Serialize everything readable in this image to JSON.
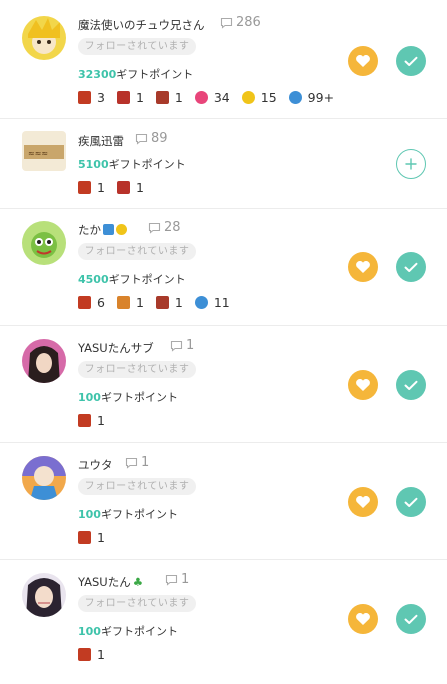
{
  "colors": {
    "accent": "#3ec3aa",
    "heart": "#f5b63a",
    "check": "#5fc7b2"
  },
  "users": [
    {
      "name": "魔法使いのチュウ兄さん",
      "comments": "286",
      "follow_badge": "フォローされています",
      "points": "32300",
      "points_suffix": "ギフトポイント",
      "gifts": [
        {
          "icon": "stamp-gift-icon",
          "count": "3"
        },
        {
          "icon": "stamp-gift-icon",
          "count": "1"
        },
        {
          "icon": "stamp-gift-icon",
          "count": "1"
        },
        {
          "icon": "pink-gift-icon",
          "count": "34"
        },
        {
          "icon": "yellow-gift-icon",
          "count": "15"
        },
        {
          "icon": "blue-gift-icon",
          "count": "99+"
        }
      ],
      "state": "following"
    },
    {
      "name": "疾風迅雷",
      "comments": "89",
      "follow_badge": "",
      "points": "5100",
      "points_suffix": "ギフトポイント",
      "gifts": [
        {
          "icon": "stamp-gift-icon",
          "count": "1"
        },
        {
          "icon": "stamp-gift-icon",
          "count": "1"
        }
      ],
      "state": "not-following"
    },
    {
      "name": "たか",
      "comments": "28",
      "follow_badge": "フォローされています",
      "points": "4500",
      "points_suffix": "ギフトポイント",
      "gifts": [
        {
          "icon": "stamp-gift-icon",
          "count": "6"
        },
        {
          "icon": "stamp-gift-icon",
          "count": "1"
        },
        {
          "icon": "stamp-gift-icon",
          "count": "1"
        },
        {
          "icon": "blue-gift-icon",
          "count": "11"
        }
      ],
      "state": "following"
    },
    {
      "name": "YASUたんサブ",
      "comments": "1",
      "follow_badge": "フォローされています",
      "points": "100",
      "points_suffix": "ギフトポイント",
      "gifts": [
        {
          "icon": "stamp-gift-icon",
          "count": "1"
        }
      ],
      "state": "following"
    },
    {
      "name": "ユウタ",
      "comments": "1",
      "follow_badge": "フォローされています",
      "points": "100",
      "points_suffix": "ギフトポイント",
      "gifts": [
        {
          "icon": "stamp-gift-icon",
          "count": "1"
        }
      ],
      "state": "following"
    },
    {
      "name": "YASUたん",
      "comments": "1",
      "follow_badge": "フォローされています",
      "points": "100",
      "points_suffix": "ギフトポイント",
      "gifts": [
        {
          "icon": "stamp-gift-icon",
          "count": "1"
        }
      ],
      "state": "following"
    }
  ]
}
